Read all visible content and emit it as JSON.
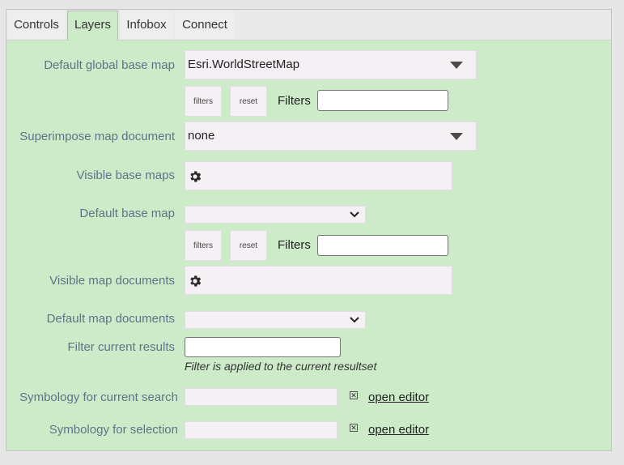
{
  "tabs": [
    {
      "label": "Controls",
      "active": false
    },
    {
      "label": "Layers",
      "active": true
    },
    {
      "label": "Infobox",
      "active": false
    },
    {
      "label": "Connect",
      "active": false
    }
  ],
  "form": {
    "default_global_base_map": {
      "label": "Default global base map",
      "value": "Esri.WorldStreetMap"
    },
    "filters_row1": {
      "filters_btn": "filters",
      "reset_btn": "reset",
      "filters_label": "Filters",
      "value": ""
    },
    "superimpose_map_document": {
      "label": "Superimpose map document",
      "value": "none"
    },
    "visible_base_maps": {
      "label": "Visible base maps"
    },
    "default_base_map": {
      "label": "Default base map",
      "value": ""
    },
    "filters_row2": {
      "filters_btn": "filters",
      "reset_btn": "reset",
      "filters_label": "Filters",
      "value": ""
    },
    "visible_map_documents": {
      "label": "Visible map documents"
    },
    "default_map_documents": {
      "label": "Default map documents",
      "value": ""
    },
    "filter_current_results": {
      "label": "Filter current results",
      "value": "",
      "note": "Filter is applied to the current resultset"
    },
    "symbology_current_search": {
      "label": "Symbology for current search",
      "checkbox": "✕",
      "link": "open editor"
    },
    "symbology_selection": {
      "label": "Symbology for selection",
      "checkbox": "✕",
      "link": "open editor"
    }
  },
  "icons": {
    "gear": "gear-icon",
    "dropdown": "chevron-down-icon"
  },
  "colors": {
    "panel_bg": "#cdebc9",
    "label_text": "#5f7387",
    "field_bg": "#f4f0f4"
  }
}
